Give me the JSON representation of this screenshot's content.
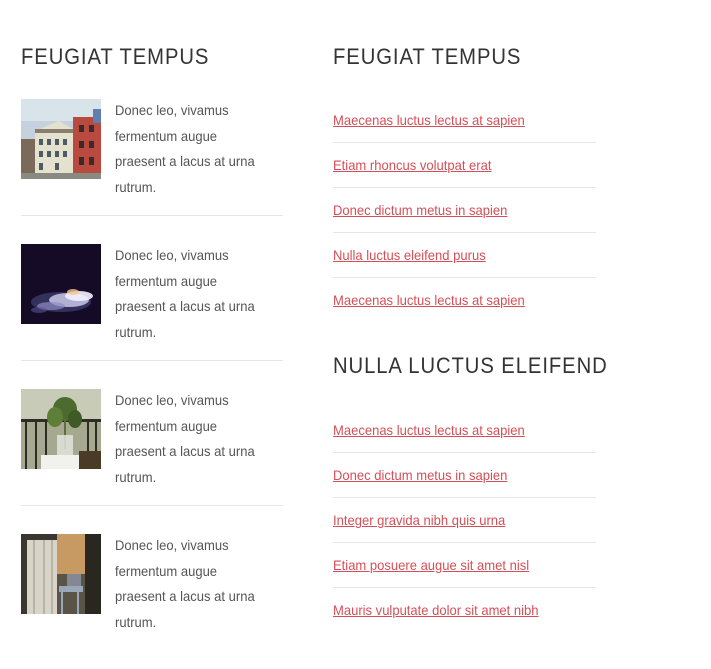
{
  "left_column": {
    "heading": "FEUGIAT TEMPUS",
    "posts": [
      {
        "text": "Donec leo, vivamus fermentum augue praesent a lacus at urna rutrum.",
        "image": "building-photo"
      },
      {
        "text": "Donec leo, vivamus fermentum augue praesent a lacus at urna rutrum.",
        "image": "smoke-photo"
      },
      {
        "text": "Donec leo, vivamus fermentum augue praesent a lacus at urna rutrum.",
        "image": "plant-vase-photo"
      },
      {
        "text": "Donec leo, vivamus fermentum augue praesent a lacus at urna rutrum.",
        "image": "window-chair-photo"
      }
    ]
  },
  "right_column": {
    "section1": {
      "heading": "FEUGIAT TEMPUS",
      "links": [
        "Maecenas luctus lectus at sapien",
        "Etiam rhoncus volutpat erat",
        "Donec dictum metus in sapien",
        "Nulla luctus eleifend purus",
        "Maecenas luctus lectus at sapien"
      ]
    },
    "section2": {
      "heading": "NULLA LUCTUS ELEIFEND",
      "links": [
        "Maecenas luctus lectus at sapien",
        "Donec dictum metus in sapien",
        "Integer gravida nibh quis urna",
        "Etiam posuere augue sit amet nisl",
        "Mauris vulputate dolor sit amet nibh"
      ]
    }
  },
  "colors": {
    "link": "#d44f57",
    "heading": "#333333",
    "body_text": "#555555",
    "divider": "#e6e6e6"
  }
}
